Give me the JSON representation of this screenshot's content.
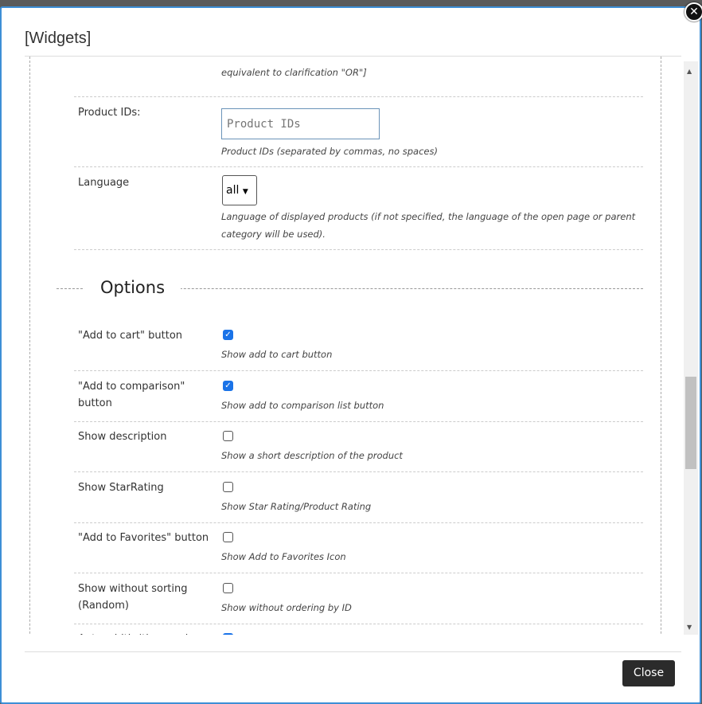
{
  "dialog": {
    "title": "[Widgets]",
    "close_label": "Close"
  },
  "top_help": "equivalent to clarification \"OR\"]",
  "product_ids": {
    "label": "Product IDs:",
    "placeholder": "Product IDs",
    "help": "Product IDs (separated by commas, no spaces)"
  },
  "language": {
    "label": "Language",
    "value": "all",
    "help": "Language of displayed products (if not specified, the language of the open page or parent category will be used)."
  },
  "options_title": "Options",
  "options": [
    {
      "label": "\"Add to cart\" button",
      "help": "Show add to cart button",
      "checked": true
    },
    {
      "label": "\"Add to comparison\" button",
      "help": "Show add to comparison list button",
      "checked": true
    },
    {
      "label": "Show description",
      "help": "Show a short description of the product",
      "checked": false
    },
    {
      "label": "Show StarRating",
      "help": "Show Star Rating/Product Rating",
      "checked": false
    },
    {
      "label": "\"Add to Favorites\" button",
      "help": "Show Add to Favorites Icon",
      "checked": false
    },
    {
      "label": "Show without sorting (Random)",
      "help": "Show without ordering by ID",
      "checked": false
    },
    {
      "label": "Auto-width (the number",
      "help": "",
      "checked": true
    }
  ]
}
